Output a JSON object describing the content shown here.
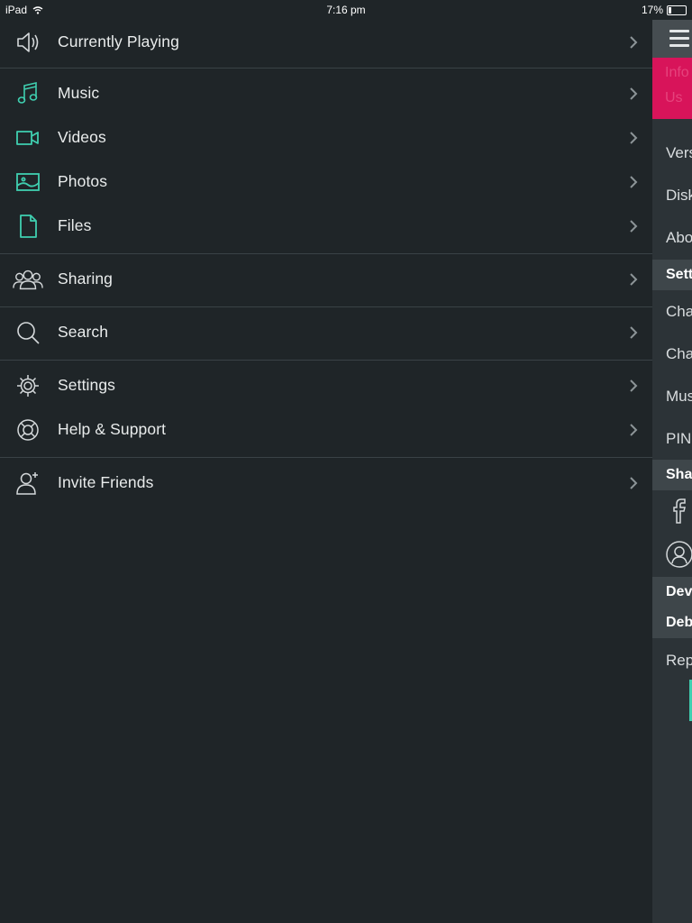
{
  "status_bar": {
    "device": "iPad",
    "time": "7:16 pm",
    "battery": "17%",
    "battery_level": 0.17
  },
  "menu": {
    "items": [
      {
        "label": "Currently Playing",
        "icon": "speaker-icon"
      },
      {
        "label": "Music",
        "icon": "music-note-icon"
      },
      {
        "label": "Videos",
        "icon": "video-camera-icon"
      },
      {
        "label": "Photos",
        "icon": "photo-icon"
      },
      {
        "label": "Files",
        "icon": "file-icon"
      },
      {
        "label": "Sharing",
        "icon": "people-icon"
      },
      {
        "label": "Search",
        "icon": "search-icon"
      },
      {
        "label": "Settings",
        "icon": "gear-icon"
      },
      {
        "label": "Help & Support",
        "icon": "lifebuoy-icon"
      },
      {
        "label": "Invite Friends",
        "icon": "add-person-icon"
      }
    ]
  },
  "panel": {
    "alert_lines": [
      "Info",
      "Us"
    ],
    "rows": {
      "version": "Vers",
      "disk": "Disk",
      "about": "Abo",
      "settings_header": "Sett",
      "change_1": "Cha",
      "change_2": "Cha",
      "music": "Mus",
      "pin": "PIN",
      "sharing_header": "Sha",
      "dev_header": "Dev",
      "debug_header": "Deb",
      "report": "Rep"
    }
  },
  "colors": {
    "background": "#1f2528",
    "accent": "#3fcfb0",
    "alert": "#d8145a",
    "divider": "#3a4246"
  }
}
